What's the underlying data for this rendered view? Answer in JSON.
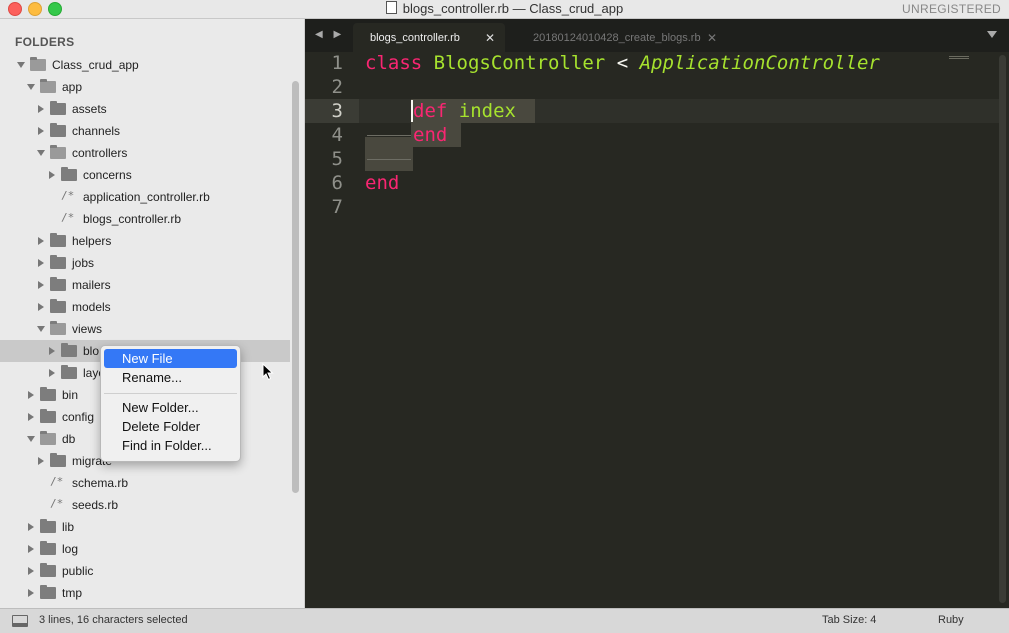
{
  "window": {
    "title": "blogs_controller.rb — Class_crud_app",
    "badge": "UNREGISTERED"
  },
  "sidebar": {
    "heading": "FOLDERS",
    "tree": [
      {
        "label": "Class_crud_app",
        "kind": "folder",
        "depth": 0,
        "expanded": true
      },
      {
        "label": "app",
        "kind": "folder",
        "depth": 1,
        "expanded": true
      },
      {
        "label": "assets",
        "kind": "folder",
        "depth": 2,
        "expanded": false
      },
      {
        "label": "channels",
        "kind": "folder",
        "depth": 2,
        "expanded": false
      },
      {
        "label": "controllers",
        "kind": "folder",
        "depth": 2,
        "expanded": true
      },
      {
        "label": "concerns",
        "kind": "folder",
        "depth": 3,
        "expanded": false
      },
      {
        "label": "application_controller.rb",
        "kind": "file",
        "depth": 3
      },
      {
        "label": "blogs_controller.rb",
        "kind": "file",
        "depth": 3
      },
      {
        "label": "helpers",
        "kind": "folder",
        "depth": 2,
        "expanded": false
      },
      {
        "label": "jobs",
        "kind": "folder",
        "depth": 2,
        "expanded": false
      },
      {
        "label": "mailers",
        "kind": "folder",
        "depth": 2,
        "expanded": false
      },
      {
        "label": "models",
        "kind": "folder",
        "depth": 2,
        "expanded": false
      },
      {
        "label": "views",
        "kind": "folder",
        "depth": 2,
        "expanded": true
      },
      {
        "label": "blo",
        "kind": "folder",
        "depth": 3,
        "expanded": false,
        "selected": true
      },
      {
        "label": "layo",
        "kind": "folder",
        "depth": 3,
        "expanded": false
      },
      {
        "label": "bin",
        "kind": "folder",
        "depth": 1,
        "expanded": false
      },
      {
        "label": "config",
        "kind": "folder",
        "depth": 1,
        "expanded": false
      },
      {
        "label": "db",
        "kind": "folder",
        "depth": 1,
        "expanded": true
      },
      {
        "label": "migrate",
        "kind": "folder",
        "depth": 2,
        "expanded": false
      },
      {
        "label": "schema.rb",
        "kind": "file",
        "depth": 2
      },
      {
        "label": "seeds.rb",
        "kind": "file",
        "depth": 2
      },
      {
        "label": "lib",
        "kind": "folder",
        "depth": 1,
        "expanded": false
      },
      {
        "label": "log",
        "kind": "folder",
        "depth": 1,
        "expanded": false
      },
      {
        "label": "public",
        "kind": "folder",
        "depth": 1,
        "expanded": false
      },
      {
        "label": "tmp",
        "kind": "folder",
        "depth": 1,
        "expanded": false
      }
    ]
  },
  "tabs": [
    {
      "label": "blogs_controller.rb",
      "active": true
    },
    {
      "label": "20180124010428_create_blogs.rb",
      "active": false
    }
  ],
  "editor": {
    "line_numbers": [
      "1",
      "2",
      "3",
      "4",
      "5",
      "6",
      "7"
    ],
    "current_line": 3,
    "code": {
      "l1_kw": "class",
      "l1_cls": "BlogsController",
      "l1_op": "<",
      "l1_inh": "ApplicationController",
      "l3_kw": "def",
      "l3_fn": "index",
      "l4_kw": "end",
      "l6_kw": "end"
    }
  },
  "context_menu": {
    "items": [
      "New File",
      "Rename...",
      "New Folder...",
      "Delete Folder",
      "Find in Folder..."
    ],
    "highlighted": "New File"
  },
  "statusbar": {
    "selection": "3 lines, 16 characters selected",
    "tab_size": "Tab Size: 4",
    "syntax": "Ruby"
  },
  "colors": {
    "keyword": "#f92672",
    "class_name": "#a6e22e",
    "editor_bg": "#272822",
    "menu_highlight": "#3478f6"
  }
}
